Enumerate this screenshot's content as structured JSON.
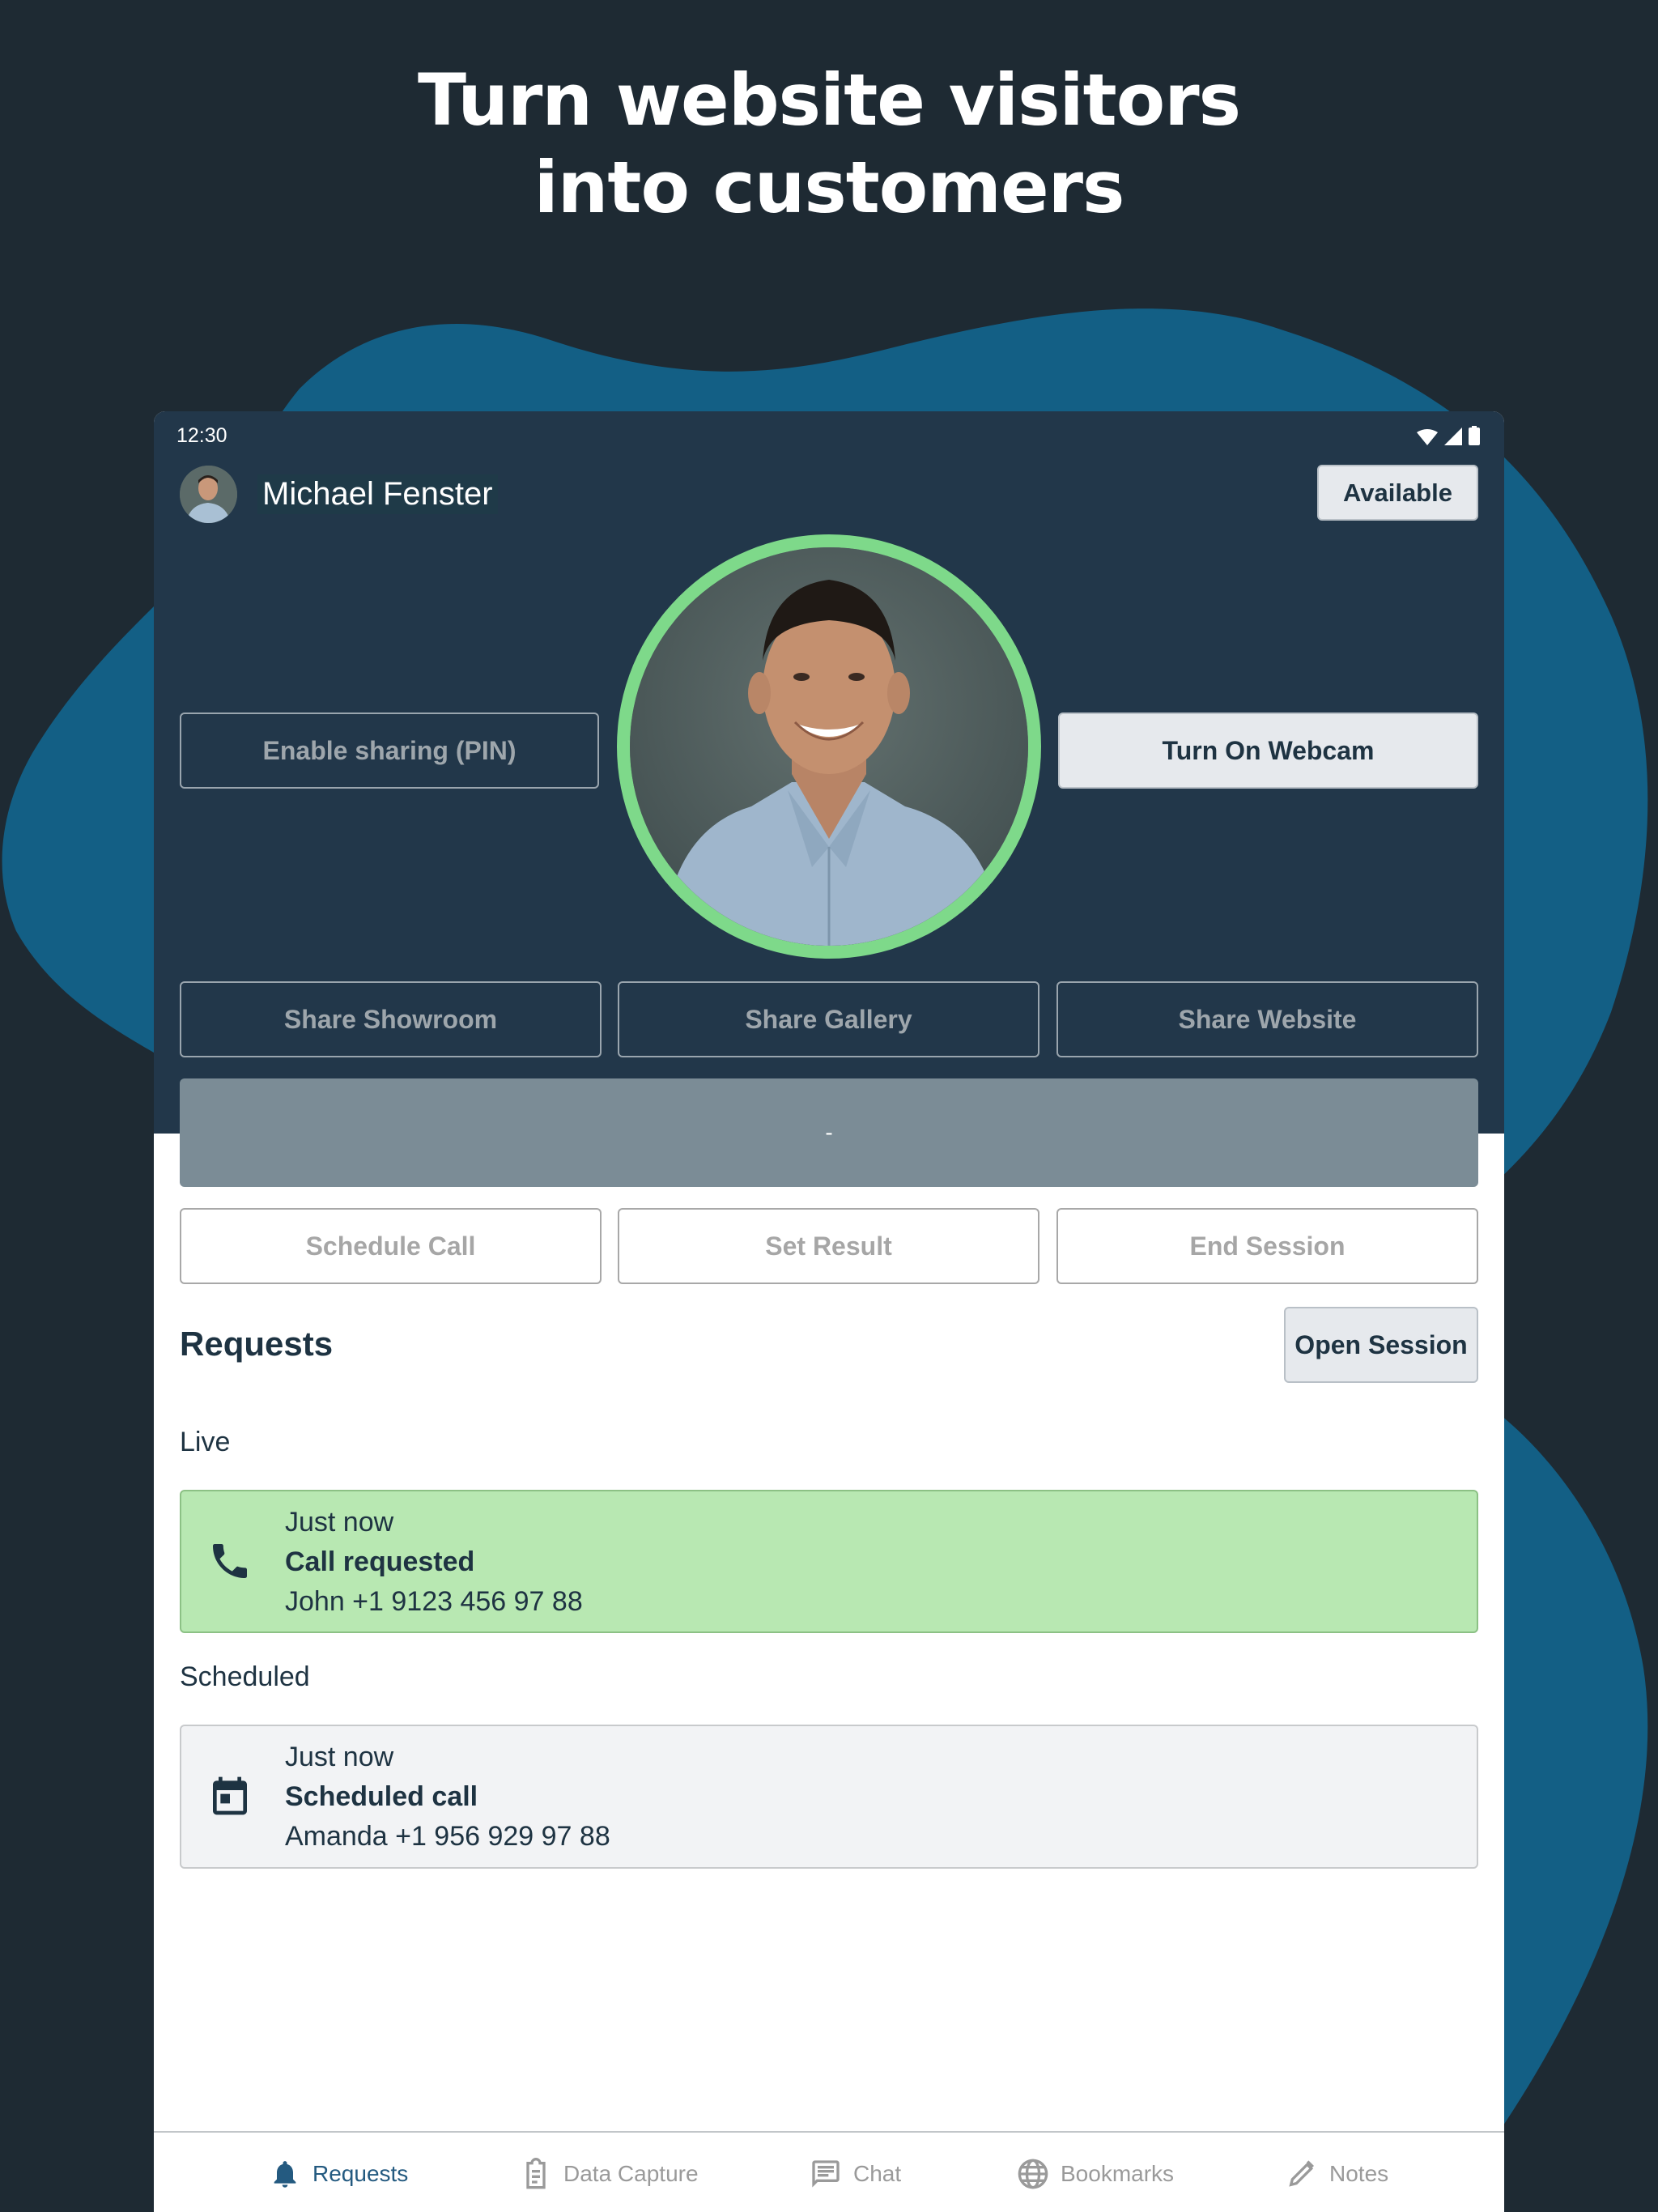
{
  "headline": {
    "line1": "Turn website visitors",
    "line2": "into customers"
  },
  "colors": {
    "background": "#1e2a33",
    "blob": "#135f85",
    "device_header": "#22374a",
    "status_ring": "#7ed98a",
    "live_card": "#b8e8b2",
    "scheduled_card": "#f2f3f5",
    "nav_active": "#245a80",
    "nav_inactive": "#9a9a9a"
  },
  "status_bar": {
    "time": "12:30",
    "icons": [
      "wifi-icon",
      "cellular-signal-icon",
      "battery-icon"
    ]
  },
  "profile": {
    "name": "Michael Fenster",
    "status_button": "Available"
  },
  "controls": {
    "enable_sharing": "Enable sharing (PIN)",
    "webcam": "Turn On Webcam",
    "share_showroom": "Share Showroom",
    "share_gallery": "Share Gallery",
    "share_website": "Share Website",
    "session_display": "-",
    "schedule_call": "Schedule Call",
    "set_result": "Set Result",
    "end_session": "End Session"
  },
  "requests": {
    "title": "Requests",
    "open_session": "Open Session",
    "live": {
      "label": "Live",
      "items": [
        {
          "time": "Just now",
          "title": "Call requested",
          "contact": "John +1 9123 456 97 88",
          "icon": "phone-icon"
        }
      ]
    },
    "scheduled": {
      "label": "Scheduled",
      "items": [
        {
          "time": "Just now",
          "title": "Scheduled call",
          "contact": "Amanda +1 956 929 97 88",
          "icon": "calendar-icon"
        }
      ]
    }
  },
  "bottom_nav": {
    "items": [
      {
        "label": "Requests",
        "icon": "bell-icon",
        "active": true
      },
      {
        "label": "Data Capture",
        "icon": "clipboard-icon",
        "active": false
      },
      {
        "label": "Chat",
        "icon": "chat-icon",
        "active": false
      },
      {
        "label": "Bookmarks",
        "icon": "globe-icon",
        "active": false
      },
      {
        "label": "Notes",
        "icon": "pencil-icon",
        "active": false
      }
    ]
  }
}
